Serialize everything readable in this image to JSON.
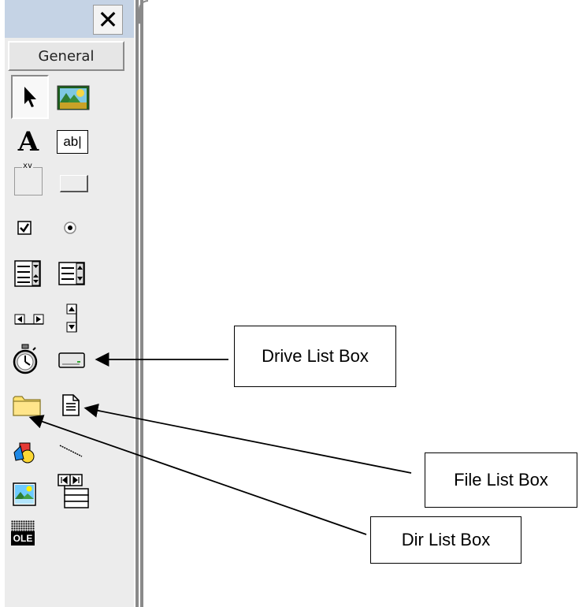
{
  "toolbox": {
    "close_label": "✕",
    "tab_label": "General",
    "ole_label": "OLE",
    "textbox_label": "ab|",
    "frame_label": "xv",
    "label_glyph": "A",
    "tools": [
      "pointer-icon",
      "picturebox-icon",
      "label-icon",
      "textbox-icon",
      "frame-icon",
      "commandbutton-icon",
      "checkbox-icon",
      "optionbutton-icon",
      "combobox-icon",
      "listbox-icon",
      "hscrollbar-icon",
      "vscrollbar-icon",
      "timer-icon",
      "drivelistbox-icon",
      "dirlistbox-icon",
      "filelistbox-icon",
      "shape-icon",
      "line-icon",
      "image-icon",
      "data-icon",
      "ole-icon"
    ]
  },
  "callouts": {
    "drive": "Drive List Box",
    "file": "File List Box",
    "dir": "Dir List Box"
  }
}
